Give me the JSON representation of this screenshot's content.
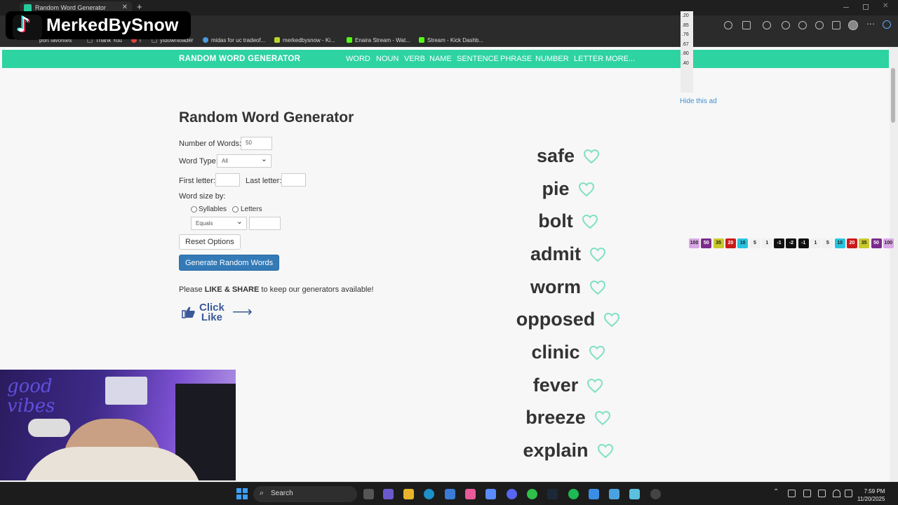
{
  "browser": {
    "tab_title": "Random Word Generator",
    "bookmarks": [
      "port favorites",
      "Thank You",
      "i",
      "ytdownloader",
      "midas for uc tradeof...",
      "merkedbysnow - Ki...",
      "Enaira Stream - Wat...",
      "Stream - Kick Dashb..."
    ]
  },
  "overlay": {
    "tiktok_name": "MerkedBySnow"
  },
  "site": {
    "brand": "RANDOM WORD GENERATOR",
    "nav": [
      "WORD",
      "NOUN",
      "VERB",
      "NAME",
      "SENTENCE",
      "PHRASE",
      "NUMBER",
      "LETTER",
      "MORE..."
    ]
  },
  "form": {
    "title": "Random Word Generator",
    "num_words_label": "Number of Words:",
    "num_words_value": "50",
    "word_type_label": "Word Type:",
    "word_type_value": "All",
    "first_letter_label": "First letter:",
    "last_letter_label": "Last letter:",
    "word_size_label": "Word size by:",
    "syllables_label": "Syllables",
    "letters_label": "Letters",
    "size_compare_value": "Equals",
    "reset_label": "Reset Options",
    "generate_label": "Generate Random Words",
    "share_prefix": "Please ",
    "share_bold": "LIKE & SHARE",
    "share_suffix": " to keep our generators available!",
    "click_like_1": "Click",
    "click_like_2": "Like"
  },
  "words": [
    "safe",
    "pie",
    "bolt",
    "admit",
    "worm",
    "opposed",
    "clinic",
    "fever",
    "breeze",
    "explain"
  ],
  "ad": {
    "hide_label": "Hide this ad",
    "side_numbers": [
      ".20",
      ".85",
      ".76",
      ".67",
      ".80",
      ".40"
    ],
    "chips": [
      {
        "t": "100",
        "c": "#d9a6e6"
      },
      {
        "t": "50",
        "c": "#7b2a8c"
      },
      {
        "t": "35",
        "c": "#c9c92a"
      },
      {
        "t": "20",
        "c": "#cc1a1a"
      },
      {
        "t": "10",
        "c": "#27c4e0"
      },
      {
        "t": "5",
        "c": "#f0f0f0"
      },
      {
        "t": "1",
        "c": "#f0f0f0"
      },
      {
        "t": "-1",
        "c": "#111111"
      },
      {
        "t": "-2",
        "c": "#111111"
      },
      {
        "t": "-1",
        "c": "#111111"
      },
      {
        "t": "1",
        "c": "#f0f0f0"
      },
      {
        "t": "5",
        "c": "#f0f0f0"
      },
      {
        "t": "10",
        "c": "#27c4e0"
      },
      {
        "t": "20",
        "c": "#cc1a1a"
      },
      {
        "t": "35",
        "c": "#c9c92a"
      },
      {
        "t": "50",
        "c": "#7b2a8c"
      },
      {
        "t": "100",
        "c": "#d9a6e6"
      }
    ]
  },
  "webcam": {
    "neon_text_1": "good",
    "neon_text_2": "vibes"
  },
  "taskbar": {
    "search_placeholder": "Search",
    "time": "7:59 PM",
    "date": "11/20/2025"
  },
  "colors": {
    "accent": "#2ed3a2",
    "heart": "#7fe0c4",
    "primary_button": "#337ab7"
  }
}
